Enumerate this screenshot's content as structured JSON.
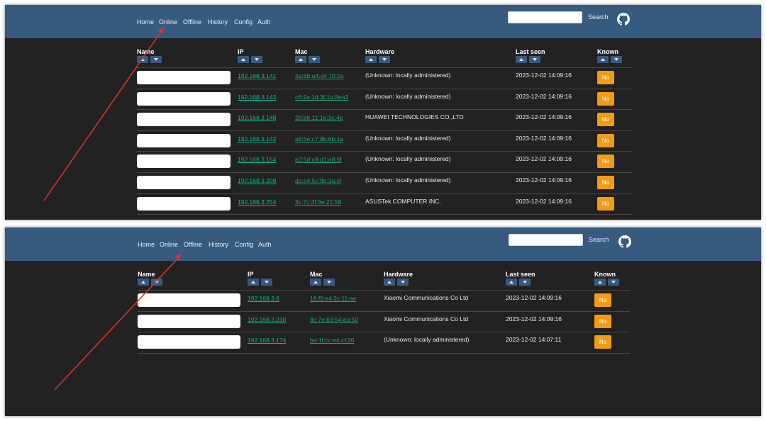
{
  "nav": {
    "links": [
      "Home",
      "Online",
      "Offline",
      "History",
      "Config",
      "Auth"
    ],
    "search_value": "",
    "search_label": "Search",
    "github_icon": "github-icon"
  },
  "columns": [
    "Name",
    "IP",
    "Mac",
    "Hardware",
    "Last seen",
    "Known"
  ],
  "panel1": {
    "rows": [
      {
        "ip": "192.168.3.141",
        "mac": "3a:6b:a4:d4:70:0a",
        "hardware": "(Unknown: locally administered)",
        "last_seen": "2023-12-02 14:09:16",
        "known": "No"
      },
      {
        "ip": "192.168.3.143",
        "mac": "c6:2a:1d:3f:1b:8ea3",
        "hardware": "(Unknown: locally administered)",
        "last_seen": "2023-12-02 14:09:16",
        "known": "No"
      },
      {
        "ip": "192.168.3.148",
        "mac": "28:b6:11:1e:3c:4e",
        "hardware": "HUAWEI TECHNOLOGIES CO.,LTD",
        "last_seen": "2023-12-02 14:09:16",
        "known": "No"
      },
      {
        "ip": "192.168.3.142",
        "mac": "a6:5e:c7:8b:6b:1a",
        "hardware": "(Unknown: locally administered)",
        "last_seen": "2023-12-02 14:09:16",
        "known": "No"
      },
      {
        "ip": "192.168.3.154",
        "mac": "e2:5d:c8:d1:a8:6f",
        "hardware": "(Unknown: locally administered)",
        "last_seen": "2023-12-02 14:09:16",
        "known": "No"
      },
      {
        "ip": "192.168.3.208",
        "mac": "da:e4:5c:8b:3a:cf",
        "hardware": "(Unknown: locally administered)",
        "last_seen": "2023-12-02 14:09:16",
        "known": "No"
      },
      {
        "ip": "192.168.3.254",
        "mac": "3c:7c:3f:9e:21:58",
        "hardware": "ASUSTek COMPUTER INC.",
        "last_seen": "2023-12-02 14:09:16",
        "known": "No"
      }
    ]
  },
  "panel2": {
    "rows": [
      {
        "ip": "192.168.3.6",
        "mac": "18:f0:e4:2c:11:ae",
        "hardware": "Xiaomi Communications Co Ltd",
        "last_seen": "2023-12-02 14:09:16",
        "known": "No"
      },
      {
        "ip": "192.168.3.238",
        "mac": "8c:7e:b3:54:ea:50",
        "hardware": "Xiaomi Communications Co Ltd",
        "last_seen": "2023-12-02 14:09:16",
        "known": "No"
      },
      {
        "ip": "192.168.3.174",
        "mac": "ba:1f:cc:e4:cf:20",
        "hardware": "(Unknown: locally administered)",
        "last_seen": "2023-12-02 14:07:11",
        "known": "No"
      }
    ]
  },
  "colors": {
    "navbar": "#375a7f",
    "background": "#222222",
    "link": "#00bc8c",
    "known_button": "#f39c12",
    "annotation_arrow": "#e03030"
  }
}
